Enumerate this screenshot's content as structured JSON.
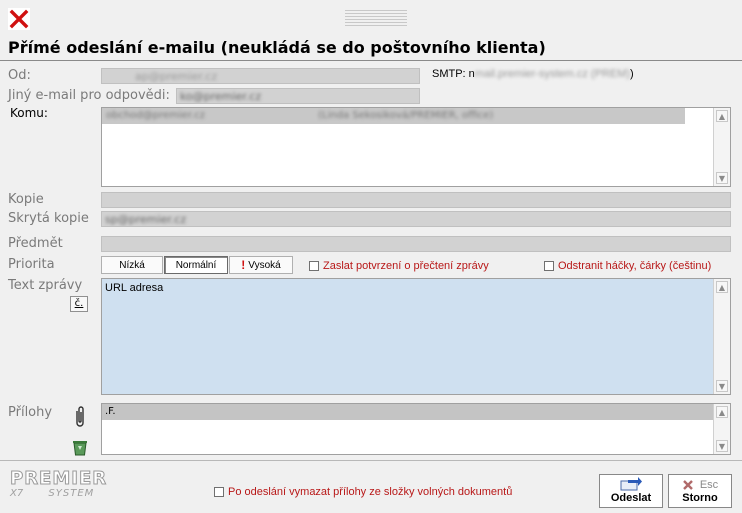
{
  "window": {
    "title": "Přímé odeslání e-mailu (neukládá se do poštovního klienta)"
  },
  "colors": {
    "close_red": "#d01010",
    "message_bg": "#cfe0f0",
    "field_gray": "#d2d2d2",
    "warning_red": "#b81818"
  },
  "from": {
    "label": "Od:",
    "value": "ap@premier.cz"
  },
  "smtp": {
    "label": "SMTP: n",
    "value": "mail.premier-system.cz (PREM)",
    "suffix": ")"
  },
  "reply_to": {
    "label": "Jiný e-mail pro odpovědi:",
    "value": "ko@premier.cz"
  },
  "to": {
    "label": "Komu:",
    "value": "obchod@premier.cz",
    "value2": "(Linda Sekosiková/PREMIER, office)"
  },
  "cc": {
    "label": "Kopie",
    "value": ""
  },
  "bcc": {
    "label": "Skrytá kopie",
    "value": "sp@premier.cz"
  },
  "subject": {
    "label": "Předmět",
    "value": ""
  },
  "priority": {
    "label": "Priorita",
    "low": "Nízká",
    "normal": "Normální",
    "high_mark": "!",
    "high": "Vysoká",
    "selected": "Normální"
  },
  "options": {
    "read_receipt": "Zaslat potvrzení o přečtení zprávy",
    "strip_diacritics": "Odstranit háčky, čárky (češtinu)"
  },
  "message": {
    "label": "Text zprávy",
    "char_button": "č.",
    "body": "URL adresa"
  },
  "attachments": {
    "label": "Přílohy",
    "row1": ".F."
  },
  "footer": {
    "logo_top": "PREMIER",
    "logo_x7": "X7",
    "logo_system": "SYSTEM",
    "delete_attachments": "Po odeslání vymazat přílohy ze složky volných dokumentů",
    "send_label": "Odeslat",
    "cancel_key": "Esc",
    "cancel_label": "Storno"
  },
  "icons": {
    "close": "close-x-icon",
    "attach": "paperclip-icon",
    "trash": "recycle-bin-icon",
    "send": "send-arrow-icon",
    "cancel": "cancel-x-icon",
    "exclaim": "exclamation-icon"
  }
}
